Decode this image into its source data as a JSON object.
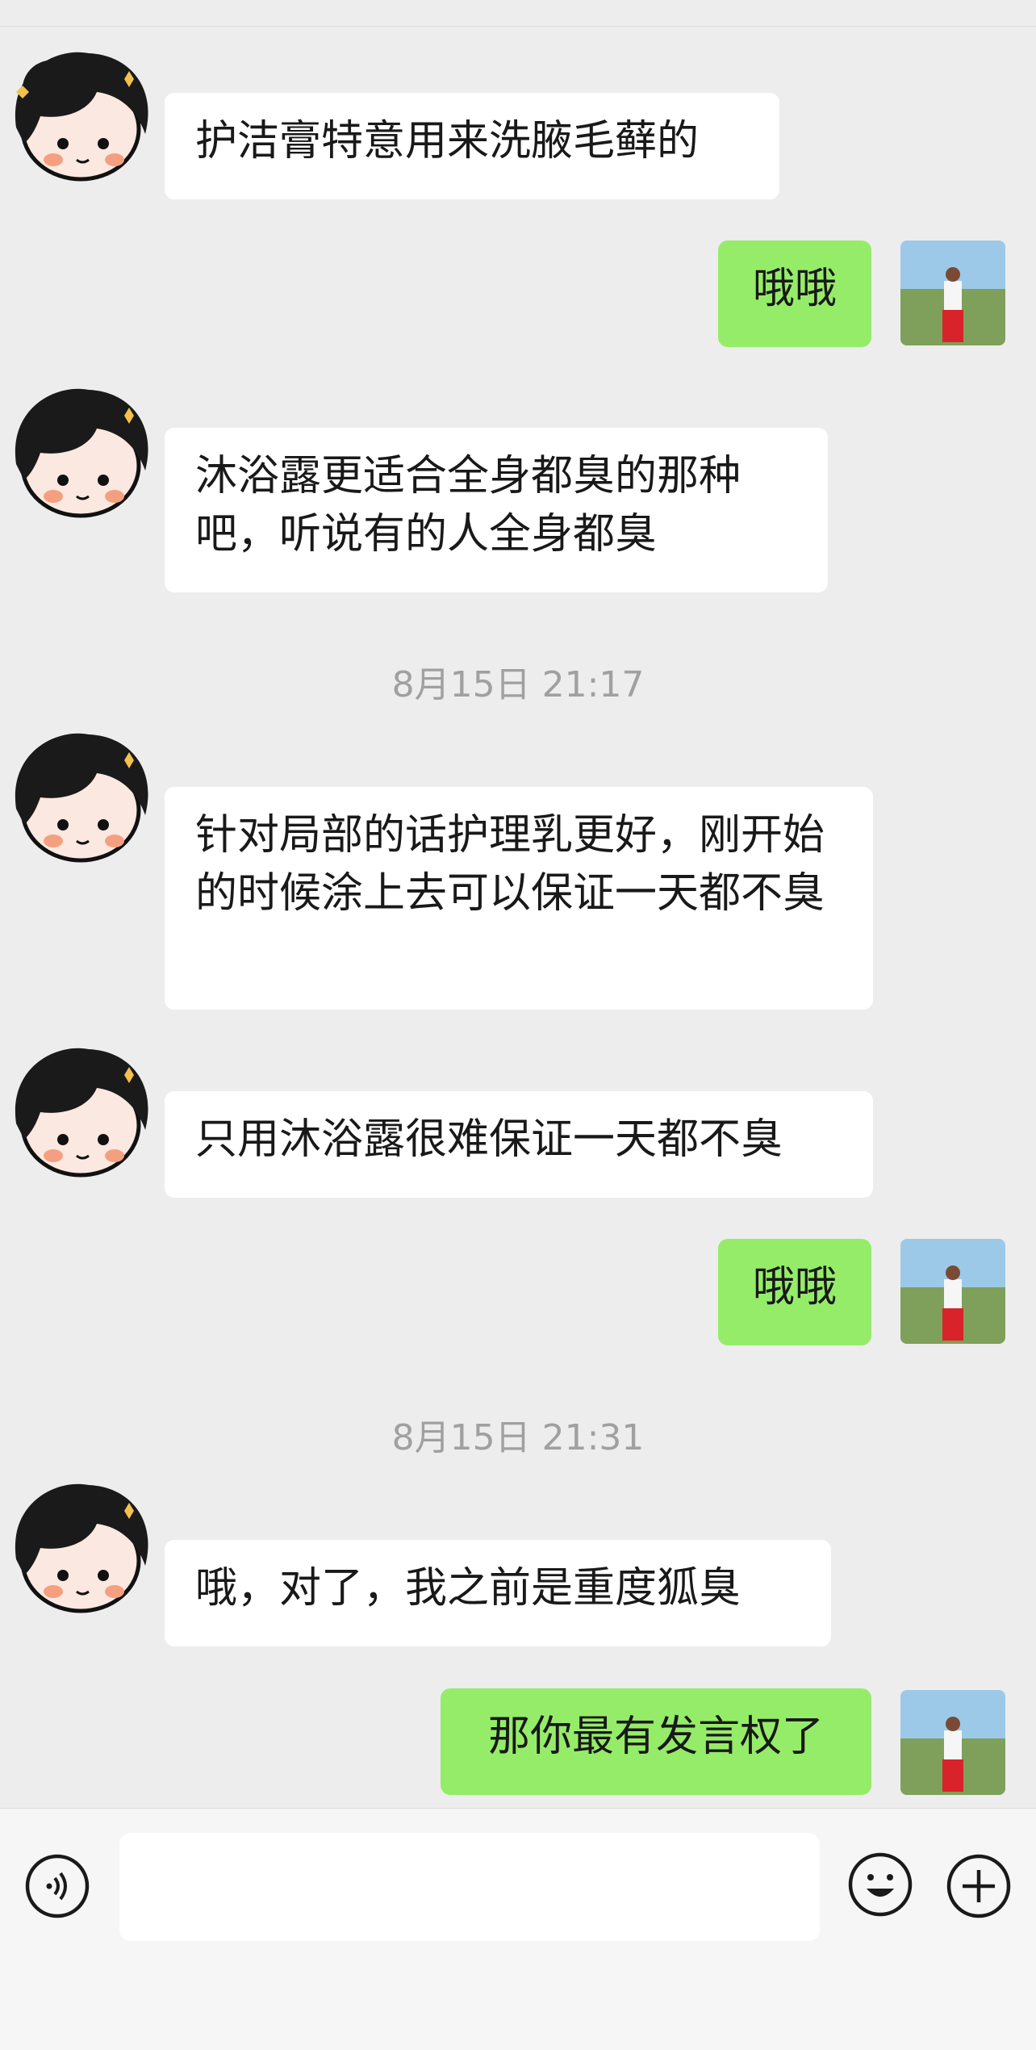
{
  "messages": [
    {
      "side": "left",
      "text": "护洁膏特意用来洗腋毛藓的"
    },
    {
      "side": "right",
      "text": "哦哦"
    },
    {
      "side": "left",
      "text": "沐浴露更适合全身都臭的那种吧，听说有的人全身都臭"
    },
    {
      "side": "left",
      "text": "针对局部的话护理乳更好，刚开始的时候涂上去可以保证一天都不臭"
    },
    {
      "side": "left",
      "text": "只用沐浴露很难保证一天都不臭"
    },
    {
      "side": "right",
      "text": "哦哦"
    },
    {
      "side": "left",
      "text": "哦，对了，我之前是重度狐臭"
    },
    {
      "side": "right",
      "text": "那你最有发言权了"
    }
  ],
  "timestamps": [
    "8月15日 21:17",
    "8月15日 21:31"
  ],
  "input": {
    "value": ""
  },
  "icons": {
    "voice": "voice-icon",
    "emoji": "emoji-icon",
    "add": "plus-icon"
  },
  "colors": {
    "background": "#ededed",
    "bubble_left": "#ffffff",
    "bubble_right": "#95ec69",
    "timestamp": "#a0a0a0"
  }
}
